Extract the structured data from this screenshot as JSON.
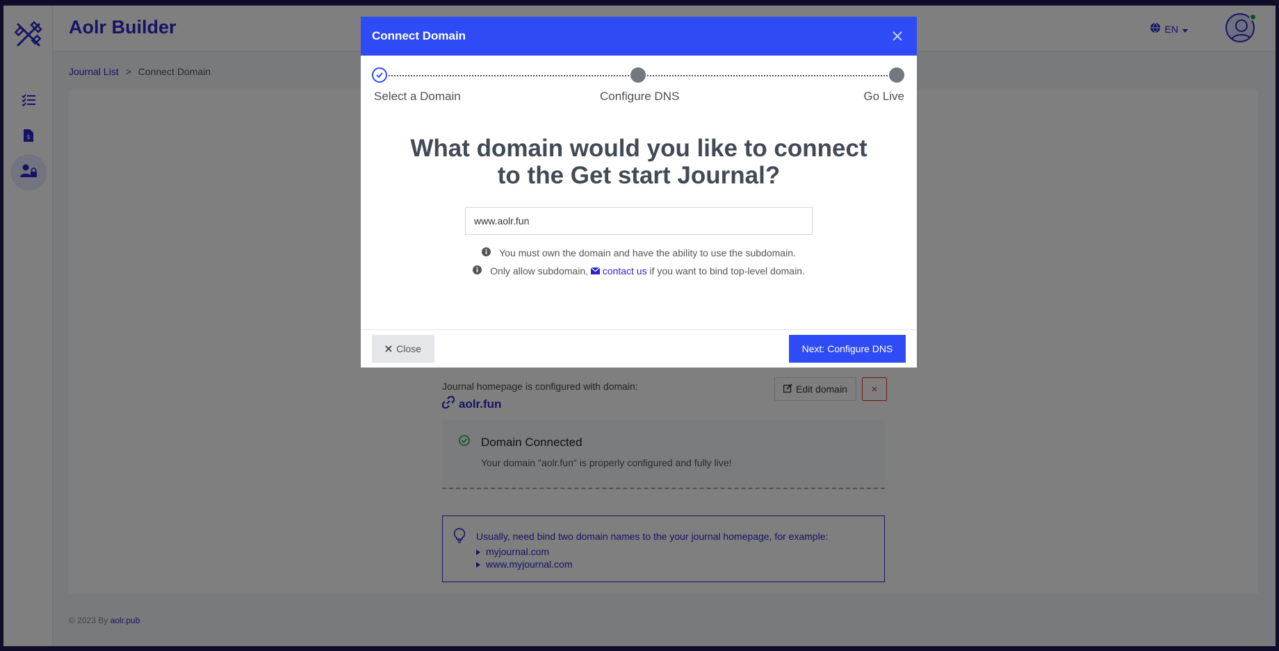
{
  "app": {
    "brand": "Aolr Builder",
    "language": "EN"
  },
  "breadcrumb": {
    "parent": "Journal List",
    "separator": ">",
    "current": "Connect Domain"
  },
  "footer": {
    "prefix": "© 2023 By",
    "link": "aolr.pub"
  },
  "domain_section": {
    "homepage_label": "Journal homepage is configured with domain:",
    "domain": "aolr.fun",
    "edit_label": "Edit domain",
    "delete_label": "×",
    "status_title": "Domain Connected",
    "status_text": "Your domain \"aolr.fun\" is properly configured and fully live!",
    "tip_text": "Usually, need bind two domain names to the your journal homepage, for example:",
    "tip_examples": [
      "myjournal.com",
      "www.myjournal.com"
    ]
  },
  "modal": {
    "title": "Connect Domain",
    "steps": [
      {
        "label": "Select a Domain",
        "state": "done"
      },
      {
        "label": "Configure DNS",
        "state": "pending"
      },
      {
        "label": "Go Live",
        "state": "pending"
      }
    ],
    "question": "What domain would you like to connect to the Get start Journal?",
    "input_value": "www.aolr.fun",
    "info_1": "You must own the domain and have the ability to use the subdomain.",
    "info_2_before": "Only allow subdomain,",
    "info_2_link": "contact us",
    "info_2_after": "if you want to bind top-level domain.",
    "close_label": "Close",
    "next_label": "Next: Configure DNS"
  },
  "colors": {
    "primary": "#2e4bf5",
    "brand": "#2d26c9",
    "success": "#1fa34a",
    "danger": "#d62c2c"
  }
}
